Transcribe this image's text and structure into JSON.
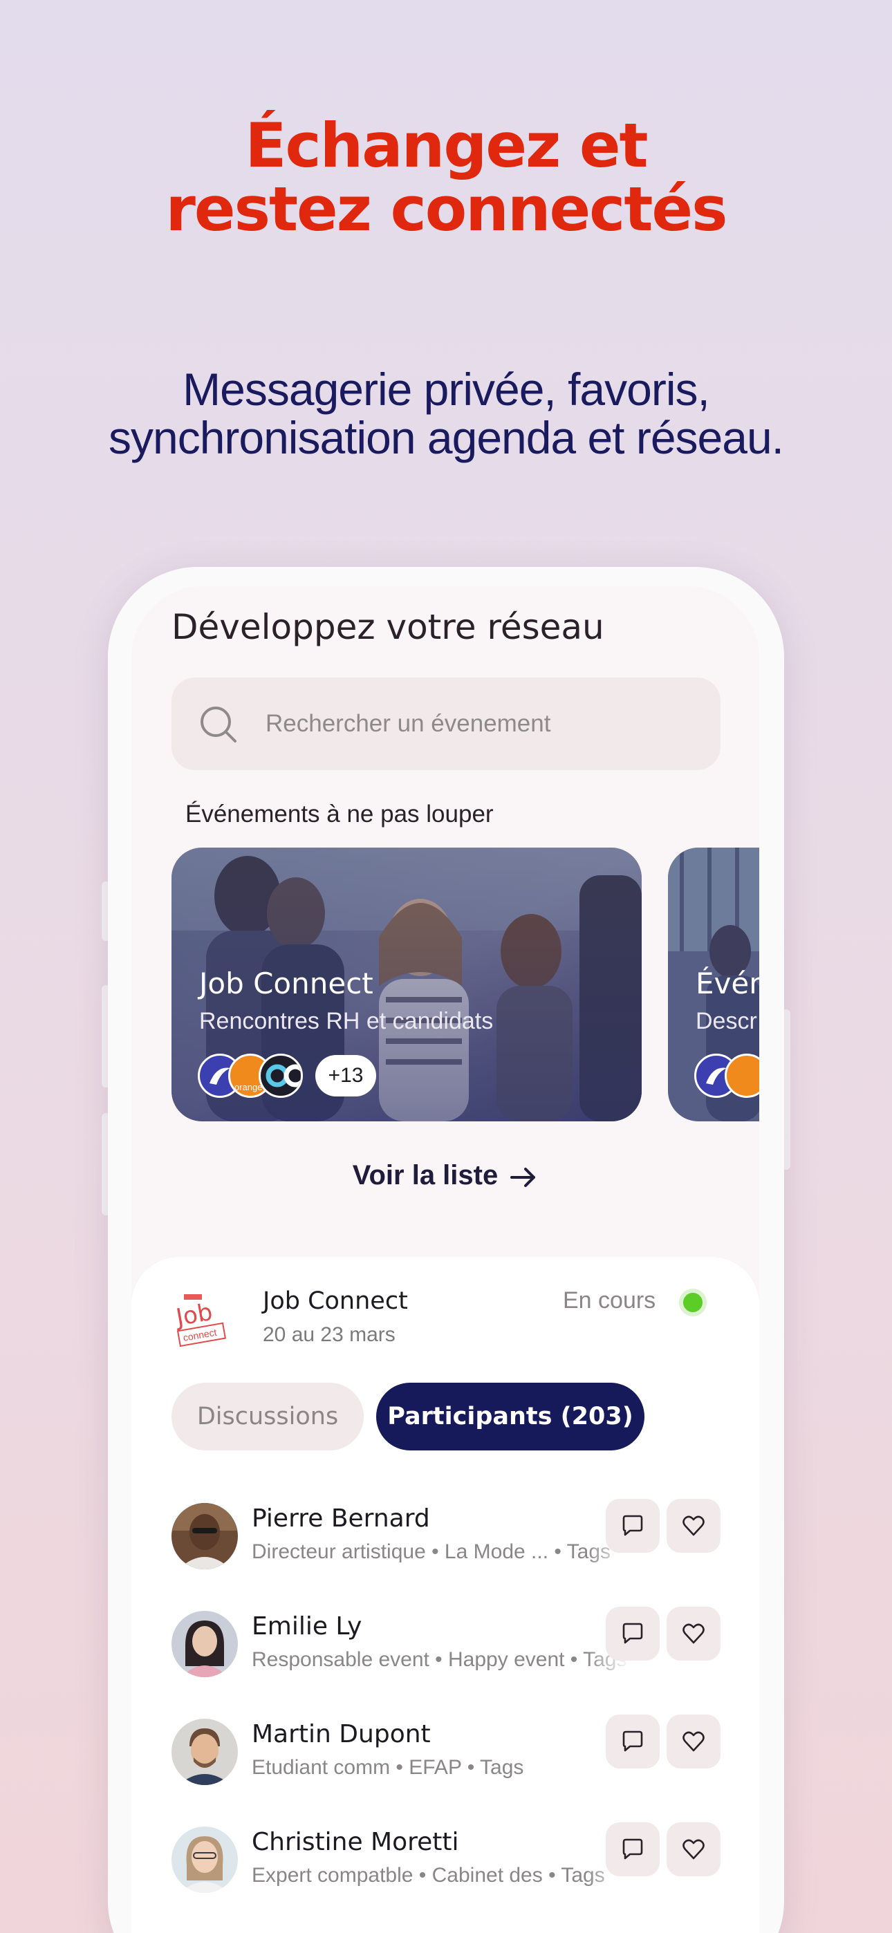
{
  "promo": {
    "headline_line1": "Échangez et",
    "headline_line2": "restez connectés",
    "subtitle_line1": "Messagerie privée, favoris,",
    "subtitle_line2": "synchronisation agenda et réseau."
  },
  "screen": {
    "title": "Développez votre réseau",
    "search": {
      "placeholder": "Rechercher un évenement",
      "icon": "search-icon"
    },
    "section_title": "Événements à ne pas louper",
    "cards": [
      {
        "title": "Job Connect",
        "subtitle": "Rencontres RH et candidats",
        "more_count": "+13",
        "sponsor_logos": [
          "orange"
        ]
      },
      {
        "title": "Évén",
        "subtitle": "Descr"
      }
    ],
    "see_list": "Voir la liste",
    "event": {
      "logo_text": "Job",
      "logo_subtext": "connect",
      "name": "Job Connect",
      "dates": "20 au 23 mars",
      "status": "En cours",
      "status_color": "#5ccc26"
    },
    "tabs": [
      {
        "label": "Discussions",
        "active": false
      },
      {
        "label": "Participants (203)",
        "active": true
      }
    ],
    "participants": [
      {
        "name": "Pierre Bernard",
        "meta": "Directeur artistique • La Mode ... • Tags",
        "avatar_bg": "#6b4a36",
        "shirt": "#e9e6e4"
      },
      {
        "name": "Emilie Ly",
        "meta": "Responsable event • Happy event • Tags",
        "avatar_bg": "#c9ced8",
        "shirt": "#e7a6b6"
      },
      {
        "name": "Martin Dupont",
        "meta": "Etudiant comm • EFAP • Tags",
        "avatar_bg": "#d8d6d3",
        "shirt": "#2f3e5c"
      },
      {
        "name": "Christine Moretti",
        "meta": "Expert compatble • Cabinet des • Tags",
        "avatar_bg": "#dde6ea",
        "shirt": "#f2f2f2"
      }
    ],
    "accent": "#16195a",
    "headline_color": "#e0280f"
  }
}
